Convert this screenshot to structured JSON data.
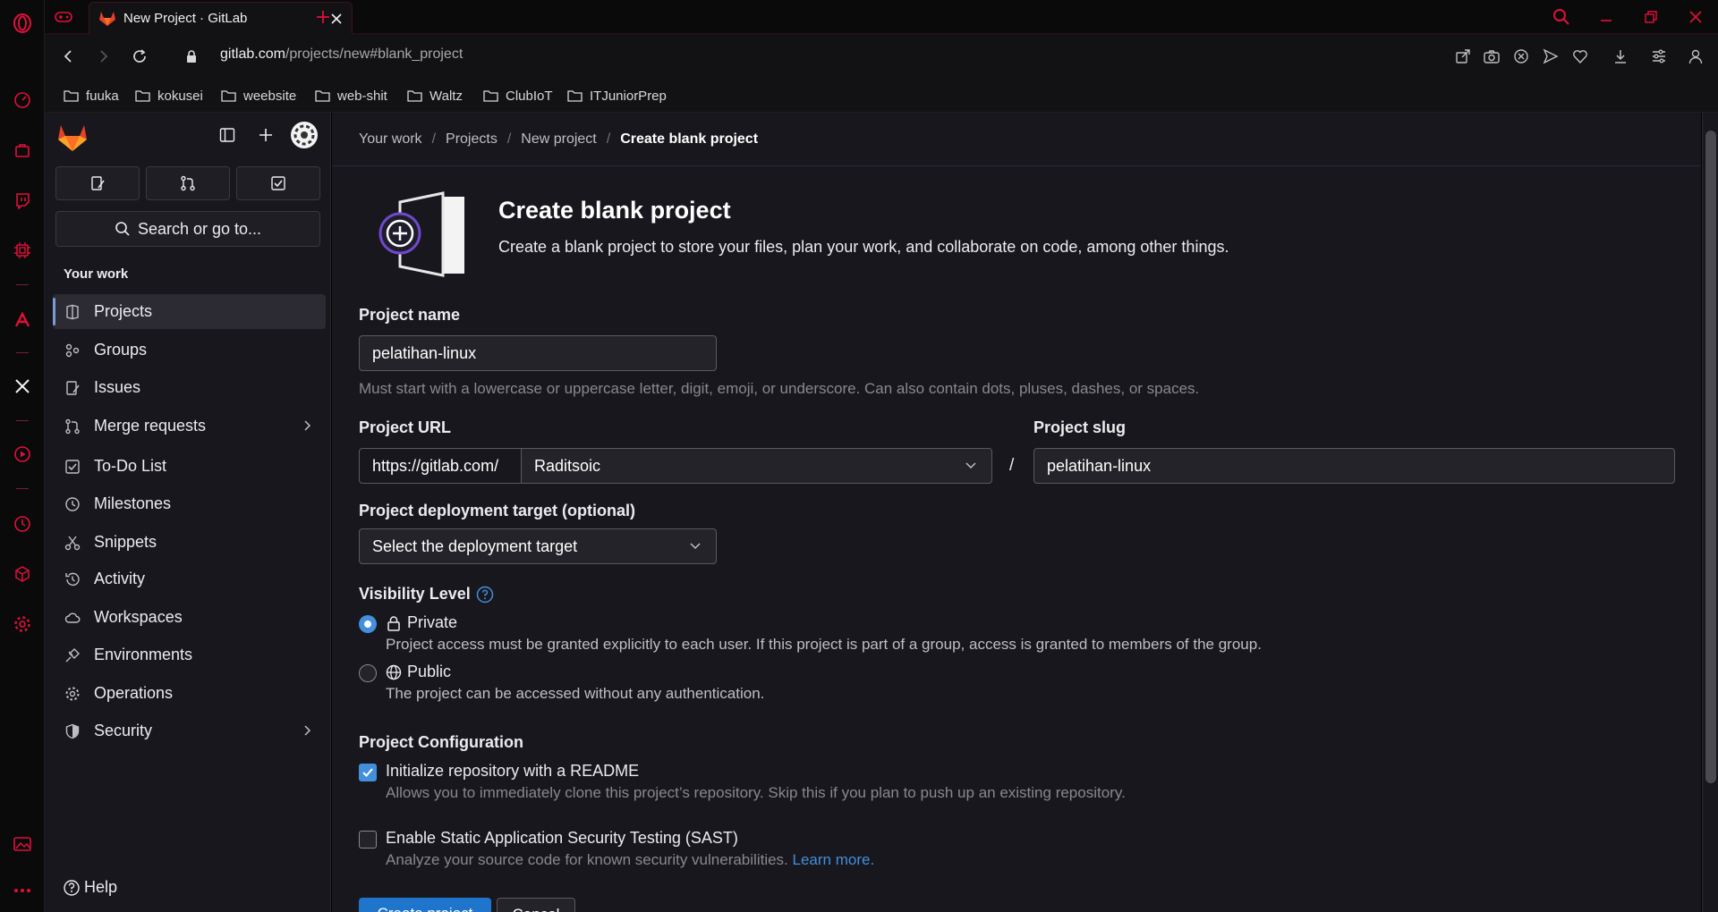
{
  "browser": {
    "tab_title": "New Project · GitLab",
    "url_host": "gitlab.com",
    "url_path": "/projects/new#blank_project",
    "bookmarks": [
      "fuuka",
      "kokusei",
      "weebsite",
      "web-shit",
      "Waltz",
      "ClubIoT",
      "ITJuniorPrep"
    ],
    "accent_color": "#e0103a"
  },
  "sidebar": {
    "search_label": "Search or go to...",
    "section_title": "Your work",
    "items": [
      {
        "label": "Projects",
        "icon": "project-icon",
        "active": true
      },
      {
        "label": "Groups",
        "icon": "group-icon"
      },
      {
        "label": "Issues",
        "icon": "issues-icon"
      },
      {
        "label": "Merge requests",
        "icon": "merge-request-icon",
        "expandable": true
      },
      {
        "label": "To-Do List",
        "icon": "todo-icon"
      },
      {
        "label": "Milestones",
        "icon": "clock-icon"
      },
      {
        "label": "Snippets",
        "icon": "snippet-icon"
      },
      {
        "label": "Activity",
        "icon": "history-icon"
      },
      {
        "label": "Workspaces",
        "icon": "cloud-icon"
      },
      {
        "label": "Environments",
        "icon": "environment-icon"
      },
      {
        "label": "Operations",
        "icon": "operations-icon"
      },
      {
        "label": "Security",
        "icon": "shield-icon",
        "expandable": true
      }
    ],
    "help_label": "Help"
  },
  "breadcrumb": [
    "Your work",
    "Projects",
    "New project",
    "Create blank project"
  ],
  "page": {
    "title": "Create blank project",
    "description": "Create a blank project to store your files, plan your work, and collaborate on code, among other things."
  },
  "form": {
    "project_name_label": "Project name",
    "project_name_value": "pelatihan-linux",
    "project_name_help": "Must start with a lowercase or uppercase letter, digit, emoji, or underscore. Can also contain dots, pluses, dashes, or spaces.",
    "project_url_label": "Project URL",
    "url_prefix": "https://gitlab.com/",
    "namespace_value": "Raditsoic",
    "slash": "/",
    "project_slug_label": "Project slug",
    "project_slug_value": "pelatihan-linux",
    "deployment_label": "Project deployment target (optional)",
    "deployment_value": "Select the deployment target",
    "visibility_label": "Visibility Level",
    "visibility_options": [
      {
        "label": "Private",
        "description": "Project access must be granted explicitly to each user. If this project is part of a group, access is granted to members of the group.",
        "selected": true
      },
      {
        "label": "Public",
        "description": "The project can be accessed without any authentication.",
        "selected": false
      }
    ],
    "config_label": "Project Configuration",
    "config_options": [
      {
        "label": "Initialize repository with a README",
        "description": "Allows you to immediately clone this project’s repository. Skip this if you plan to push up an existing repository.",
        "checked": true
      },
      {
        "label": "Enable Static Application Security Testing (SAST)",
        "description": "Analyze your source code for known security vulnerabilities.",
        "link": "Learn more.",
        "checked": false
      }
    ],
    "create_button": "Create project",
    "cancel_button": "Cancel"
  }
}
